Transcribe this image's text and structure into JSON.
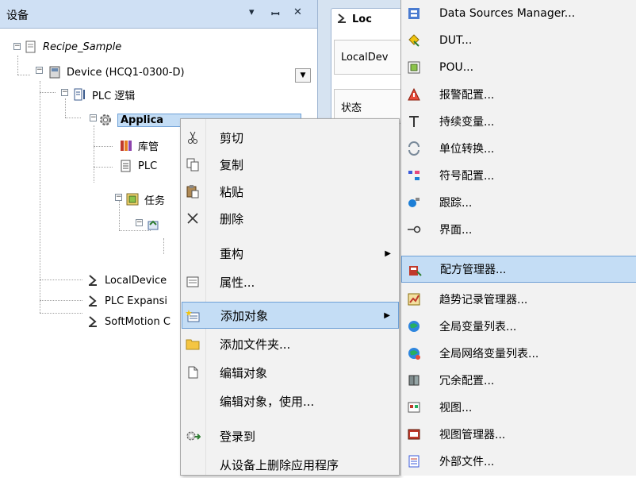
{
  "panel": {
    "title": "设备",
    "pin_glyph": "▾",
    "pin2_glyph": "ᵗ",
    "close_glyph": "✕"
  },
  "tree": {
    "recipe_sample": "Recipe_Sample",
    "device": "Device (HCQ1-0300-D)",
    "plc_logic": "PLC 逻辑",
    "application": "Applica",
    "library": "库管",
    "plc_settings": "PLC",
    "task": "任务",
    "local_device": "LocalDevice",
    "plc_expansion": "PLC Expansi",
    "softmotion": "SoftMotion C"
  },
  "editor": {
    "tab_label": "Loc",
    "btn1": "LocalDev",
    "btn2": "状态"
  },
  "context_menu": {
    "items": [
      {
        "label": "剪切",
        "icon": "scissors-icon"
      },
      {
        "label": "复制",
        "icon": "copy-icon"
      },
      {
        "label": "粘贴",
        "icon": "paste-icon"
      },
      {
        "label": "删除",
        "icon": "delete-icon"
      },
      {
        "label": "重构",
        "icon": ""
      },
      {
        "label": "属性...",
        "icon": "properties-icon"
      },
      {
        "label": "添加对象",
        "icon": "add-object-icon"
      },
      {
        "label": "添加文件夹...",
        "icon": "folder-icon"
      },
      {
        "label": "编辑对象",
        "icon": "edit-object-icon"
      },
      {
        "label": "编辑对象，使用...",
        "icon": ""
      },
      {
        "label": "登录到",
        "icon": "login-icon"
      },
      {
        "label": "从设备上删除应用程序",
        "icon": ""
      }
    ]
  },
  "submenu": {
    "items": [
      {
        "label": "Data Sources Manager...",
        "icon": "data-sources-icon"
      },
      {
        "label": "DUT...",
        "icon": "dut-icon"
      },
      {
        "label": "POU...",
        "icon": "pou-icon"
      },
      {
        "label": "报警配置...",
        "icon": "alarm-icon"
      },
      {
        "label": "持续变量...",
        "icon": "persistent-var-icon"
      },
      {
        "label": "单位转换...",
        "icon": "unit-conversion-icon"
      },
      {
        "label": "符号配置...",
        "icon": "symbol-config-icon"
      },
      {
        "label": "跟踪...",
        "icon": "trace-icon"
      },
      {
        "label": "界面...",
        "icon": "interface-icon"
      },
      {
        "label": "配方管理器...",
        "icon": "recipe-manager-icon"
      },
      {
        "label": "趋势记录管理器...",
        "icon": "trend-icon"
      },
      {
        "label": "全局变量列表...",
        "icon": "global-var-icon"
      },
      {
        "label": "全局网络变量列表...",
        "icon": "network-var-icon"
      },
      {
        "label": "冗余配置...",
        "icon": "redundancy-icon"
      },
      {
        "label": "视图...",
        "icon": "view-icon"
      },
      {
        "label": "视图管理器...",
        "icon": "view-manager-icon"
      },
      {
        "label": "外部文件...",
        "icon": "external-file-icon"
      }
    ]
  },
  "colors": {
    "highlight": "#c4ddf5",
    "highlight_border": "#6ea0d6",
    "header_bg": "#cfe0f4"
  }
}
